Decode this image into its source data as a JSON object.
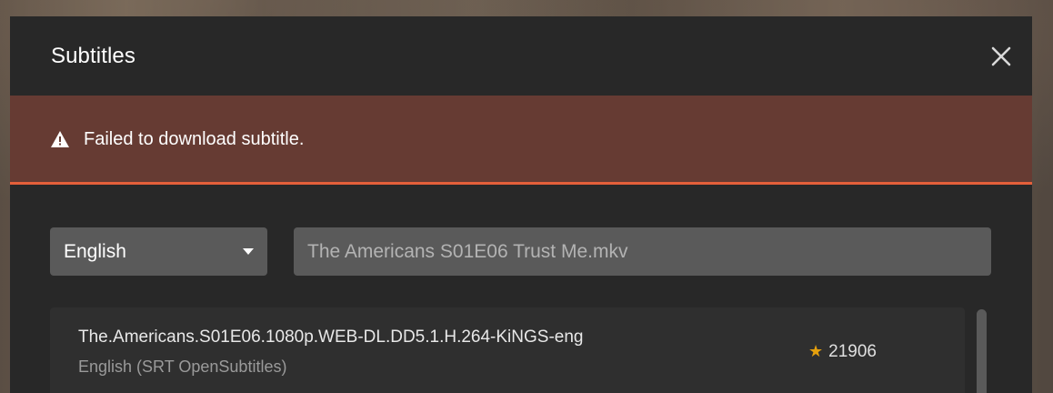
{
  "modal": {
    "title": "Subtitles",
    "close_icon": "close-icon"
  },
  "alert": {
    "icon": "warning-triangle-icon",
    "message": "Failed to download subtitle.",
    "accent_color": "#e5603a",
    "background_color": "#663b33"
  },
  "filters": {
    "language": {
      "selected": "English"
    },
    "search": {
      "value": "The Americans S01E06 Trust Me.mkv"
    }
  },
  "results": [
    {
      "name": "The.Americans.S01E06.1080p.WEB-DL.DD5.1.H.264-KiNGS-eng",
      "meta": "English (SRT OpenSubtitles)",
      "rating_icon": "star-icon",
      "rating_count": "21906"
    }
  ],
  "colors": {
    "modal_bg": "#282828",
    "input_bg": "#5a5a5a",
    "star": "#e5a00d"
  }
}
